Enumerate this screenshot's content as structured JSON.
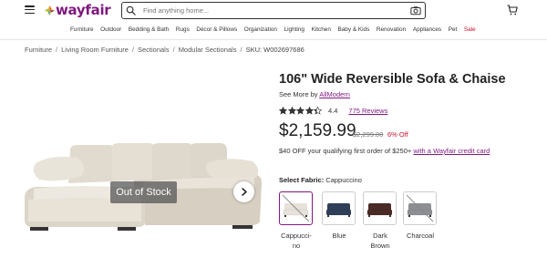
{
  "header": {
    "logo_text": "wayfair",
    "search_placeholder": "Find anything home..."
  },
  "nav": [
    "Furniture",
    "Outdoor",
    "Bedding & Bath",
    "Rugs",
    "Décor & Pillows",
    "Organization",
    "Lighting",
    "Kitchen",
    "Baby & Kids",
    "Renovation",
    "Appliances",
    "Pet",
    "Sale"
  ],
  "breadcrumb": {
    "items": [
      "Furniture",
      "Living Room Furniture",
      "Sectionals",
      "Modular Sectionals"
    ],
    "sku": "SKU: W002697686"
  },
  "product": {
    "title": "106\" Wide Reversible Sofa & Chaise",
    "see_more_prefix": "See More by",
    "brand": "AllModern",
    "rating": "4.4",
    "rating_fraction": 0.88,
    "reviews": "775 Reviews",
    "price": "$2,159.99",
    "original_price": "$2,299.00",
    "discount": "6% Off",
    "promo_text": "$40 OFF your qualifying first order of $250+",
    "promo_link": "with a Wayfair credit card",
    "image_overlay": "Out of Stock"
  },
  "fabric": {
    "label": "Select Fabric:",
    "selected": "Cappuccino",
    "options": [
      {
        "name": "Cappucci-\nno",
        "color": "#e7e2da"
      },
      {
        "name": "Blue",
        "color": "#2f3f57"
      },
      {
        "name": "Dark\nBrown",
        "color": "#4a2a24"
      },
      {
        "name": "Charcoal",
        "color": "#8d8f92"
      }
    ]
  },
  "colors": {
    "brand": "#7f187f",
    "sale": "#c8102e"
  }
}
